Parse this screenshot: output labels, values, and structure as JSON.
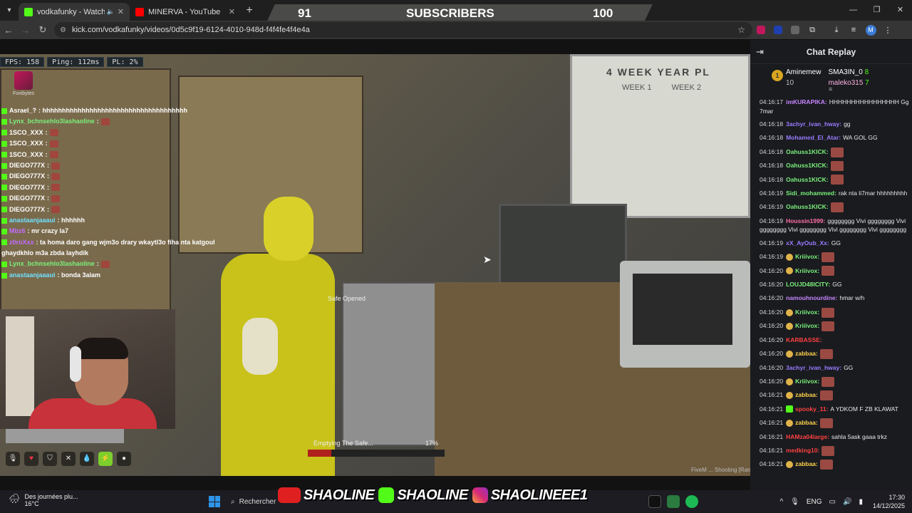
{
  "browser": {
    "tabs": [
      {
        "title": "vodkafunky - Watch the VO",
        "favicon_color": "#53fc18",
        "active": true
      },
      {
        "title": "MINERVA - YouTube",
        "favicon_color": "#ff0000",
        "active": false
      }
    ],
    "url": "kick.com/vodkafunky/videos/0d5c9f19-6124-4010-948d-f4f4fe4f4e4a",
    "profile_initial": "M"
  },
  "subscribers": {
    "current": "91",
    "label": "SUBSCRIBERS",
    "goal": "100"
  },
  "game": {
    "stats": {
      "fps": "FPS: 158",
      "ping": "Ping: 112ms",
      "pl": "PL: 2%"
    },
    "logo_text": "Foxibytes",
    "chat": [
      {
        "user": "Asrael_?",
        "text": ": hhhhhhhhhhhhhhhhhhhhhhhhhhhhhhhhhhhhh",
        "color": "white",
        "emote": false
      },
      {
        "user": "Lynx_bchnsehlo3lashaoline",
        "text": ":",
        "color": "green",
        "emote": true
      },
      {
        "user": "1SCO_XXX",
        "text": ":",
        "color": "white",
        "emote": true
      },
      {
        "user": "1SCO_XXX",
        "text": ":",
        "color": "white",
        "emote": true
      },
      {
        "user": "1SCO_XXX",
        "text": ":",
        "color": "white",
        "emote": true
      },
      {
        "user": "DIEGO777X",
        "text": ":",
        "color": "white",
        "emote": true
      },
      {
        "user": "DIEGO777X",
        "text": ":",
        "color": "white",
        "emote": true
      },
      {
        "user": "DIEGO777X",
        "text": ":",
        "color": "white",
        "emote": true
      },
      {
        "user": "DIEGO777X",
        "text": ":",
        "color": "white",
        "emote": true
      },
      {
        "user": "DIEGO777X",
        "text": ":",
        "color": "white",
        "emote": true
      },
      {
        "user": "anastaanjaaaui",
        "text": ": hhhhhh",
        "color": "cyan",
        "emote": false
      },
      {
        "user": "Mbz6",
        "text": ": mr crazy la7",
        "color": "purple",
        "emote": false
      },
      {
        "user": "z0roXxx",
        "text": ": ta homa daro gang wjm3o drary wkaytl3o fiha nta katgoul",
        "color": "purple",
        "emote": false
      },
      {
        "user": "",
        "text": "ghaydkhlo m3a zbda layhdik",
        "color": "white",
        "emote": false
      },
      {
        "user": "Lynx_bchnsehlo3lashaoline",
        "text": ":",
        "color": "green",
        "emote": true
      },
      {
        "user": "anastaanjaaaui",
        "text": ": bonda 3alam",
        "color": "cyan",
        "emote": false
      }
    ],
    "safe_opened": "Safe Opened",
    "progress_label": "Emptying The Safe...",
    "progress_percent": "17%",
    "progress_value": 0.17,
    "watermark": "FiveM ... Shooting [Ranked]"
  },
  "chat_replay": {
    "title": "Chat Replay",
    "top_gifters": [
      {
        "name": "Aminemew",
        "count": "10"
      },
      {
        "name": "SMA3IN_0",
        "count": "8"
      },
      {
        "name": "maleko315",
        "count": "7"
      }
    ],
    "messages": [
      {
        "time": "04:16:17",
        "user": "imKURAPIKA:",
        "text": "HHHHHHHHHHHHHHHH Gg 7mar",
        "color": "#c785ff",
        "emote": false,
        "badge": "",
        "wrap": true
      },
      {
        "time": "04:16:18",
        "user": "3achyr_ivan_hway:",
        "text": "gg",
        "color": "#9a7bff",
        "emote": false,
        "badge": ""
      },
      {
        "time": "04:16:18",
        "user": "Mohamed_El_Atar:",
        "text": "WA GOL GG",
        "color": "#9a7bff",
        "emote": false,
        "badge": ""
      },
      {
        "time": "04:16:18",
        "user": "Oahuss1KICK:",
        "text": "",
        "color": "#7bf07b",
        "emote": true,
        "badge": ""
      },
      {
        "time": "04:16:18",
        "user": "Oahuss1KICK:",
        "text": "",
        "color": "#7bf07b",
        "emote": true,
        "badge": ""
      },
      {
        "time": "04:16:18",
        "user": "Oahuss1KICK:",
        "text": "",
        "color": "#7bf07b",
        "emote": true,
        "badge": ""
      },
      {
        "time": "04:16:19",
        "user": "Sidi_mohammed:",
        "text": "rak nta li7mar hhhhhhhhh",
        "color": "#7bf07b",
        "emote": false,
        "badge": ""
      },
      {
        "time": "04:16:19",
        "user": "Oahuss1KICK:",
        "text": "",
        "color": "#7bf07b",
        "emote": true,
        "badge": ""
      },
      {
        "time": "04:16:19",
        "user": "Houssin1999:",
        "text": "gggggggg Vivi gggggggg Vivi gggggggg Vivi gggggggg Vivi gggggggg Vivi gggggggg",
        "color": "#ff6fa8",
        "emote": false,
        "badge": "",
        "wrap": true
      },
      {
        "time": "04:16:19",
        "user": "xX_AyOub_Xx:",
        "text": "GG",
        "color": "#9a7bff",
        "emote": false,
        "badge": ""
      },
      {
        "time": "04:16:19",
        "user": "Kriiivox:",
        "text": "",
        "color": "#7bf07b",
        "emote": true,
        "badge": "gold"
      },
      {
        "time": "04:16:20",
        "user": "Kriiivox:",
        "text": "",
        "color": "#7bf07b",
        "emote": true,
        "badge": "gold"
      },
      {
        "time": "04:16:20",
        "user": "LOUJD48ICITY:",
        "text": "GG",
        "color": "#7bf07b",
        "emote": false,
        "badge": ""
      },
      {
        "time": "04:16:20",
        "user": "namouhnourdine:",
        "text": "hmar w/h",
        "color": "#c785ff",
        "emote": false,
        "badge": ""
      },
      {
        "time": "04:16:20",
        "user": "Kriiivox:",
        "text": "",
        "color": "#7bf07b",
        "emote": true,
        "badge": "gold"
      },
      {
        "time": "04:16:20",
        "user": "Kriiivox:",
        "text": "",
        "color": "#7bf07b",
        "emote": true,
        "badge": "gold"
      },
      {
        "time": "04:16:20",
        "user": "KARBASSE:",
        "text": "",
        "color": "#ff4040",
        "emote": false,
        "badge": ""
      },
      {
        "time": "04:16:20",
        "user": "zabbaa:",
        "text": "",
        "color": "#ffd24a",
        "emote": true,
        "badge": "gold"
      },
      {
        "time": "04:16:20",
        "user": "3achyr_ivan_hway:",
        "text": "GG",
        "color": "#9a7bff",
        "emote": false,
        "badge": ""
      },
      {
        "time": "04:16:20",
        "user": "Kriiivox:",
        "text": "",
        "color": "#7bf07b",
        "emote": true,
        "badge": "gold"
      },
      {
        "time": "04:16:21",
        "user": "zabbaa:",
        "text": "",
        "color": "#ffd24a",
        "emote": true,
        "badge": "gold"
      },
      {
        "time": "04:16:21",
        "user": "spooky_11:",
        "text": "A YDKOM F ZB KLAWAT",
        "color": "#ff4040",
        "emote": false,
        "badge": "green"
      },
      {
        "time": "04:16:21",
        "user": "zabbaa:",
        "text": "",
        "color": "#ffd24a",
        "emote": true,
        "badge": "gold"
      },
      {
        "time": "04:16:21",
        "user": "HAMza04large:",
        "text": "sahla 5ask gaaa trkz",
        "color": "#ff4040",
        "emote": false,
        "badge": ""
      },
      {
        "time": "04:16:21",
        "user": "medking10:",
        "text": "",
        "color": "#ff4040",
        "emote": true,
        "badge": ""
      },
      {
        "time": "04:16:21",
        "user": "zabbaa:",
        "text": "",
        "color": "#ffd24a",
        "emote": true,
        "badge": "gold"
      }
    ]
  },
  "taskbar": {
    "weather_text": "Des journées plu...",
    "weather_temp": "16°C",
    "search_placeholder": "Rechercher",
    "social": [
      "SHAOLINE",
      "SHAOLINE",
      "SHAOLINEEE1"
    ],
    "language": "ENG",
    "time": "17:30",
    "date": "14/12/2025"
  }
}
